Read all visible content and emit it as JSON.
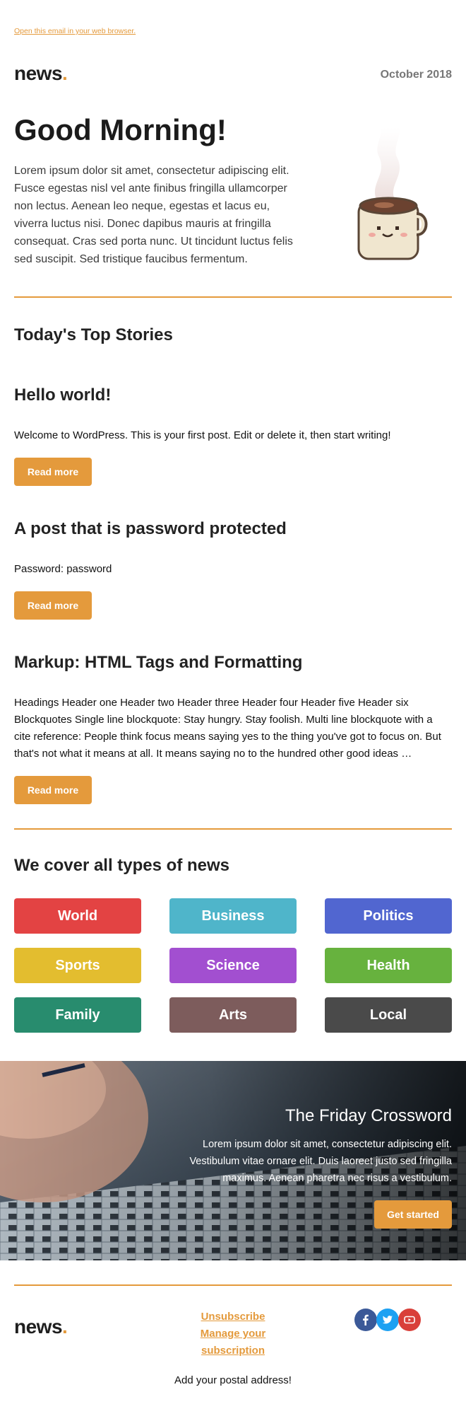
{
  "preheader": {
    "browser_link": "Open this email in your web browser."
  },
  "header": {
    "logo_text": "news",
    "logo_dot": ".",
    "date": "October 2018"
  },
  "hero": {
    "title": "Good Morning!",
    "text": "Lorem ipsum dolor sit amet, consectetur adipiscing elit. Fusce egestas nisl vel ante finibus fringilla ullamcorper non lectus. Aenean leo neque, egestas et lacus eu, viverra luctus nisi. Donec dapibus mauris at fringilla consequat. Cras sed porta nunc. Ut tincidunt luctus felis sed suscipit. Sed tristique faucibus fermentum.",
    "image_icon": "coffee-cup-icon"
  },
  "top_stories": {
    "heading": "Today's Top Stories",
    "stories": [
      {
        "title": "Hello world!",
        "excerpt": "Welcome to WordPress. This is your first post. Edit or delete it, then start writing!",
        "button": "Read more"
      },
      {
        "title": "A post that is password protected",
        "excerpt": "Password: password",
        "button": "Read more"
      },
      {
        "title": "Markup: HTML Tags and Formatting",
        "excerpt": "Headings Header one Header two Header three Header four Header five Header six Blockquotes Single line blockquote: Stay hungry. Stay foolish. Multi line blockquote with a cite reference: People think focus means saying yes to the thing you've got to focus on. But that's not what it means at all. It means saying no to the hundred other good ideas …",
        "button": "Read more"
      }
    ]
  },
  "categories": {
    "heading": "We cover all types of news",
    "items": [
      {
        "label": "World",
        "color": "#e34343"
      },
      {
        "label": "Business",
        "color": "#4fb5ca"
      },
      {
        "label": "Politics",
        "color": "#5166d0"
      },
      {
        "label": "Sports",
        "color": "#e3bd2f"
      },
      {
        "label": "Science",
        "color": "#a24fd0"
      },
      {
        "label": "Health",
        "color": "#67b23e"
      },
      {
        "label": "Family",
        "color": "#288c6e"
      },
      {
        "label": "Arts",
        "color": "#7d5c5c"
      },
      {
        "label": "Local",
        "color": "#4a4a4a"
      }
    ]
  },
  "crossword": {
    "title": "The Friday Crossword",
    "text": "Lorem ipsum dolor sit amet, consectetur adipiscing elit. Vestibulum vitae ornare elit. Duis laoreet justo sed fringilla maximus. Aenean pharetra nec risus a vestibulum.",
    "button": "Get started"
  },
  "footer": {
    "logo_text": "news",
    "logo_dot": ".",
    "unsubscribe": "Unsubscribe",
    "manage": "Manage your subscription",
    "social": [
      {
        "icon": "facebook-icon",
        "color": "#3b5998"
      },
      {
        "icon": "twitter-icon",
        "color": "#1da1f2"
      },
      {
        "icon": "youtube-icon",
        "color": "#d9403a"
      }
    ],
    "postal": "Add your postal address!"
  },
  "colors": {
    "accent": "#e49a3c",
    "text": "#222222"
  }
}
